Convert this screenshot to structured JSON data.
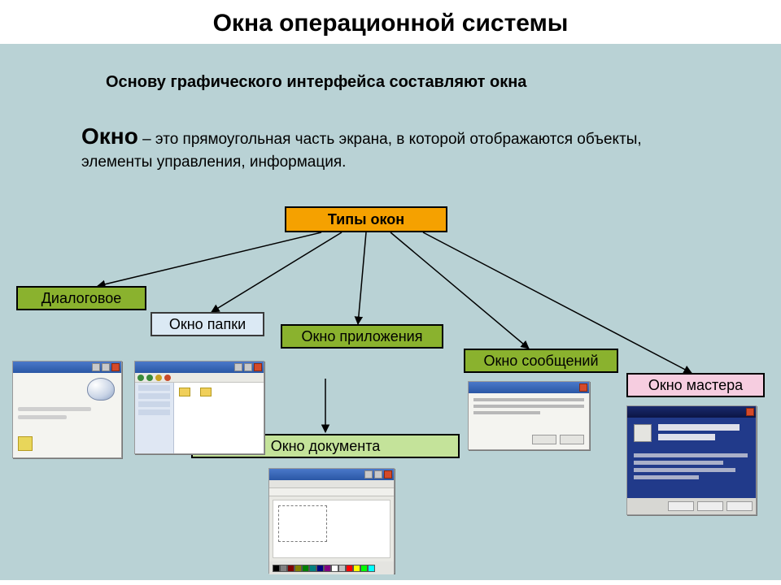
{
  "title": "Окна операционной системы",
  "intro": "Основу графического интерфейса составляют окна",
  "definition": {
    "term": "Окно",
    "text": " – это прямоугольная часть экрана, в которой отображаются объекты, элементы управления, информация."
  },
  "root_label": "Типы окон",
  "leaves": {
    "dialog": "Диалоговое",
    "folder": "Окно папки",
    "app": "Окно приложения",
    "msg": "Окно сообщений",
    "wizard": "Окно мастера",
    "doc": "Окно документа"
  },
  "palette": [
    "#000000",
    "#808080",
    "#800000",
    "#808000",
    "#008000",
    "#008080",
    "#000080",
    "#800080",
    "#ffffff",
    "#c0c0c0",
    "#ff0000",
    "#ffff00",
    "#00ff00",
    "#00ffff"
  ]
}
